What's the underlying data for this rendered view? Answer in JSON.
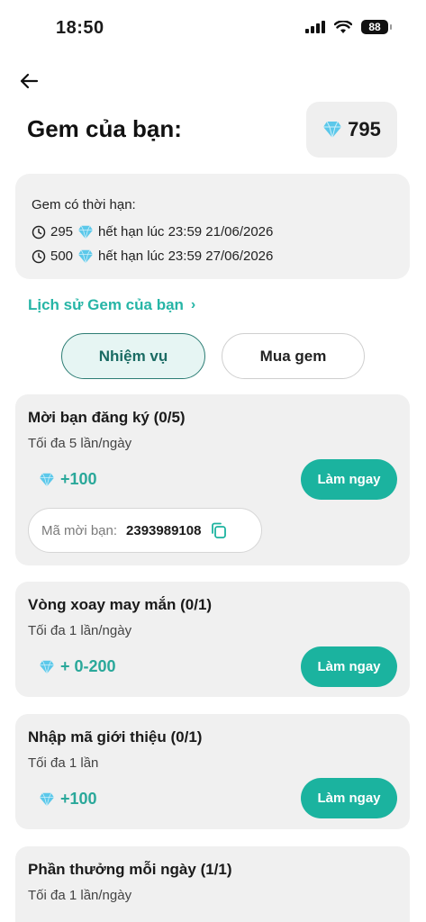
{
  "status_bar": {
    "time": "18:50",
    "battery": "88"
  },
  "header": {
    "title": "Gem của bạn:",
    "gem_total": "795"
  },
  "expiry": {
    "title": "Gem có thời hạn:",
    "items": [
      {
        "amount": "295",
        "text": "hết hạn lúc 23:59 21/06/2026"
      },
      {
        "amount": "500",
        "text": "hết hạn lúc 23:59 27/06/2026"
      }
    ]
  },
  "history_link": "Lịch sử Gem của bạn",
  "tabs": [
    {
      "label": "Nhiệm vụ",
      "active": true
    },
    {
      "label": "Mua gem",
      "active": false
    }
  ],
  "tasks": [
    {
      "title": "Mời bạn đăng ký (0/5)",
      "subtitle": "Tối đa 5 lần/ngày",
      "reward": "+100",
      "button": "Làm ngay",
      "invite": {
        "label": "Mã mời bạn:",
        "code": "2393989108"
      }
    },
    {
      "title": "Vòng xoay may mắn (0/1)",
      "subtitle": "Tối đa 1 lần/ngày",
      "reward": "+ 0-200",
      "button": "Làm ngay"
    },
    {
      "title": "Nhập mã giới thiệu (0/1)",
      "subtitle": "Tối đa 1 lần",
      "reward": "+100",
      "button": "Làm ngay"
    },
    {
      "title": "Phần thưởng mỗi ngày (1/1)",
      "subtitle": "Tối đa 1 lần/ngày"
    }
  ],
  "colors": {
    "accent": "#1bb39f",
    "gem": "#5bc8ea"
  },
  "icons": {
    "back": "arrow-left-icon",
    "gem": "gem-icon",
    "clock": "clock-icon",
    "copy": "copy-icon"
  }
}
